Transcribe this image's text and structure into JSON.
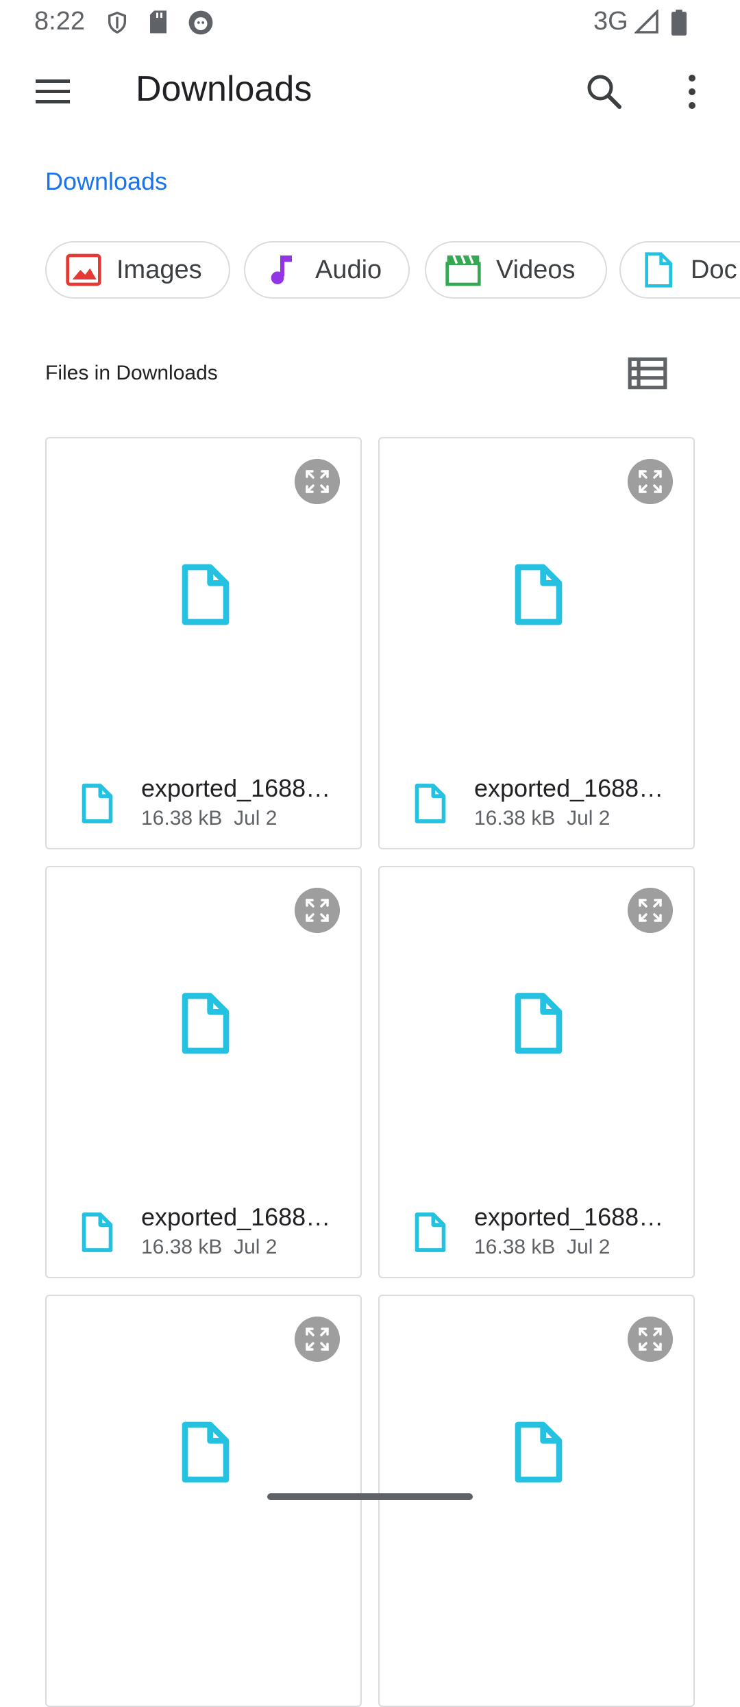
{
  "status_bar": {
    "time": "8:22",
    "network": "3G"
  },
  "app_bar": {
    "title": "Downloads"
  },
  "breadcrumb": "Downloads",
  "chips": [
    {
      "label": "Images",
      "icon": "image-icon",
      "color": "#e53935"
    },
    {
      "label": "Audio",
      "icon": "music-note-icon",
      "color": "#9334e6"
    },
    {
      "label": "Videos",
      "icon": "movie-icon",
      "color": "#34a853"
    },
    {
      "label": "Doc",
      "icon": "document-icon",
      "color": "#24c1e0"
    }
  ],
  "section": {
    "label": "Files in Downloads"
  },
  "files": [
    {
      "name": "exported_1688…",
      "size": "16.38 kB",
      "date": "Jul 2"
    },
    {
      "name": "exported_1688…",
      "size": "16.38 kB",
      "date": "Jul 2"
    },
    {
      "name": "exported_1688…",
      "size": "16.38 kB",
      "date": "Jul 2"
    },
    {
      "name": "exported_1688…",
      "size": "16.38 kB",
      "date": "Jul 2"
    },
    {
      "name": "",
      "size": "",
      "date": ""
    },
    {
      "name": "",
      "size": "",
      "date": ""
    }
  ],
  "colors": {
    "accent": "#1a73e8",
    "file_icon": "#24c1e0",
    "expand_button": "#9e9e9e"
  }
}
